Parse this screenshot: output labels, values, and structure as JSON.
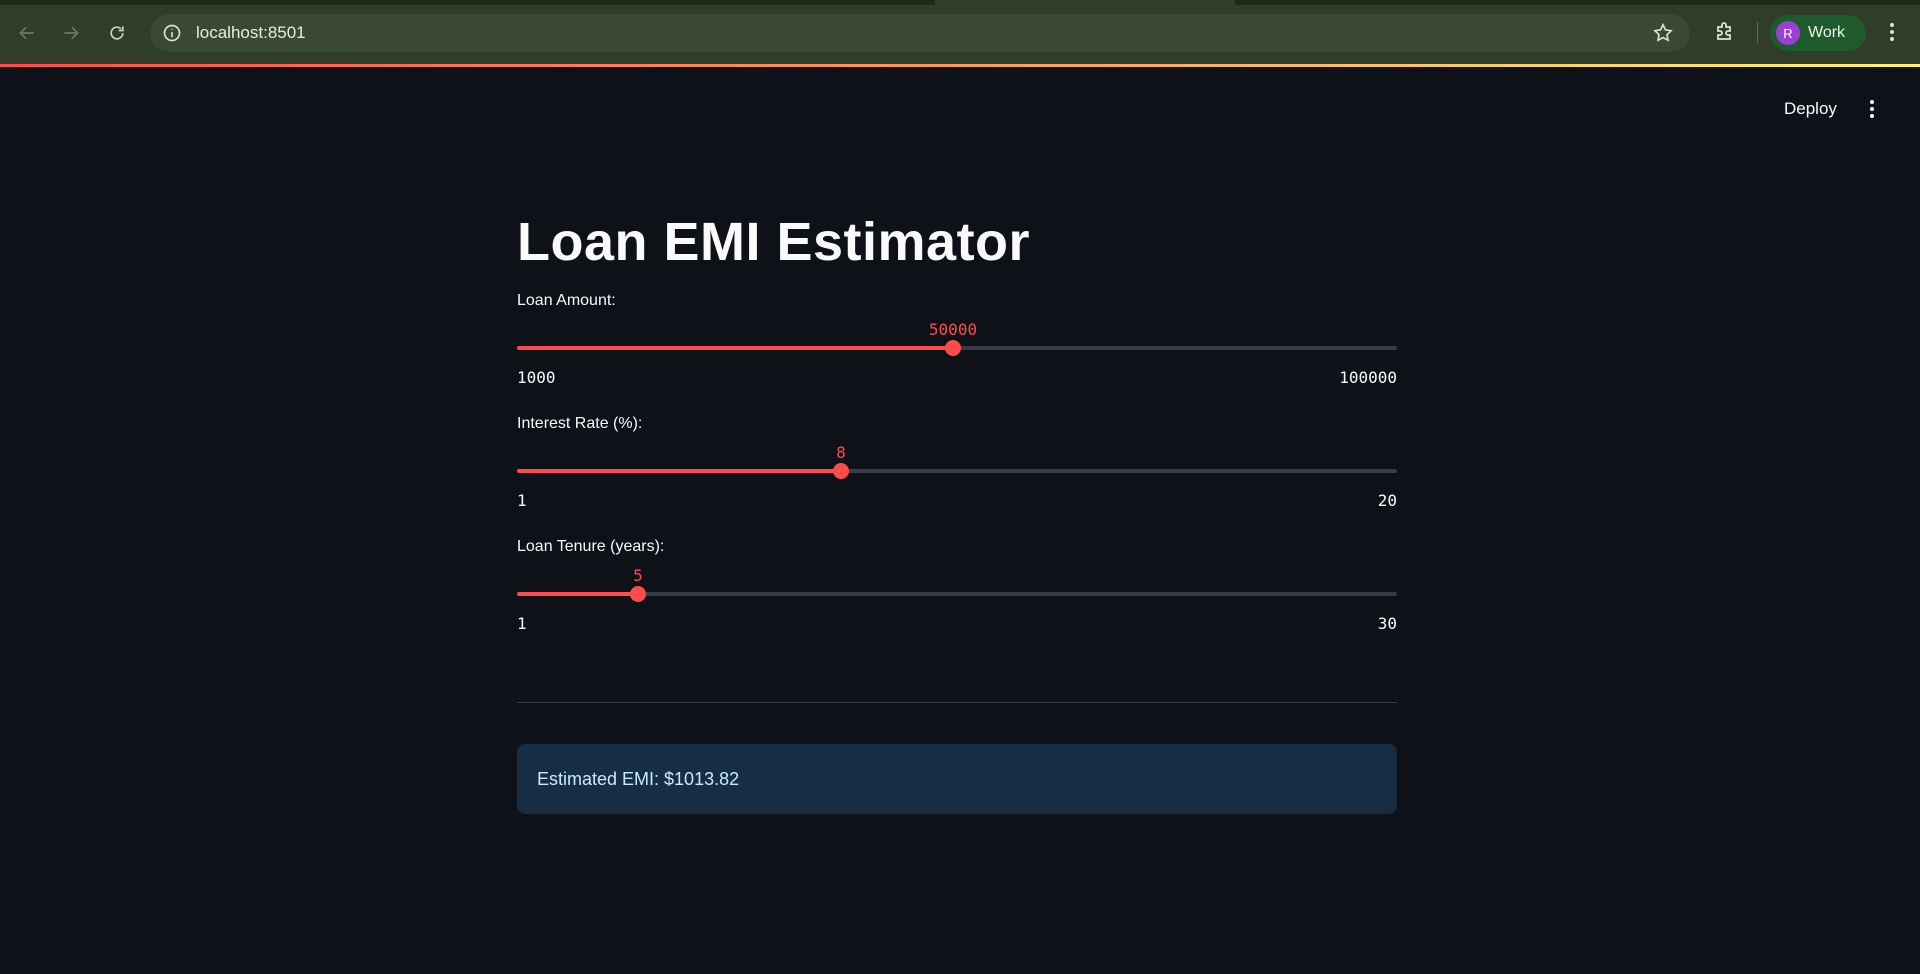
{
  "browser": {
    "url": "localhost:8501",
    "profile": {
      "initial": "R",
      "name": "Work"
    },
    "icons": [
      "back-arrow-icon",
      "forward-arrow-icon",
      "reload-icon",
      "info-icon",
      "star-icon",
      "extensions-icon",
      "more-vert-icon"
    ]
  },
  "header": {
    "deploy_label": "Deploy",
    "menu_icon": "more-vert-icon"
  },
  "app": {
    "title": "Loan EMI Estimator",
    "sliders": [
      {
        "label": "Loan Amount:",
        "value": "50000",
        "min": "1000",
        "max": "100000",
        "fraction": 0.495
      },
      {
        "label": "Interest Rate (%):",
        "value": "8",
        "min": "1",
        "max": "20",
        "fraction": 0.368
      },
      {
        "label": "Loan Tenure (years):",
        "value": "5",
        "min": "1",
        "max": "30",
        "fraction": 0.138
      }
    ],
    "result": "Estimated EMI: $1013.82"
  },
  "colors": {
    "accent": "#ff4b4b",
    "background": "#0e1117",
    "result_bg": "#172d43",
    "result_text": "#c7ebff"
  }
}
